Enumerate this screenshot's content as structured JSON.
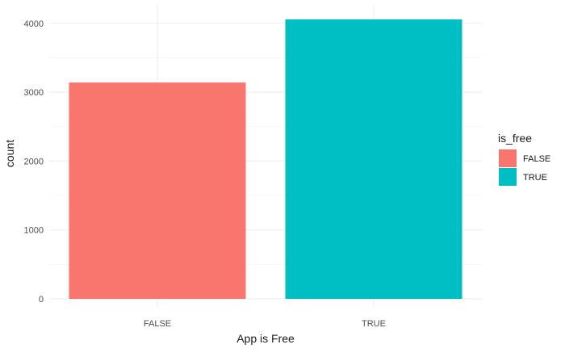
{
  "chart_data": {
    "type": "bar",
    "categories": [
      "FALSE",
      "TRUE"
    ],
    "values": [
      3140,
      4056
    ],
    "xlabel": "App is Free",
    "ylabel": "count",
    "ylim": [
      0,
      4150
    ],
    "yticks": [
      0,
      1000,
      2000,
      3000,
      4000
    ],
    "grid": true,
    "legend": {
      "title": "is_free",
      "position": "right",
      "entries": [
        "FALSE",
        "TRUE"
      ]
    },
    "colors": [
      "#F8766D",
      "#00BFC4"
    ]
  }
}
